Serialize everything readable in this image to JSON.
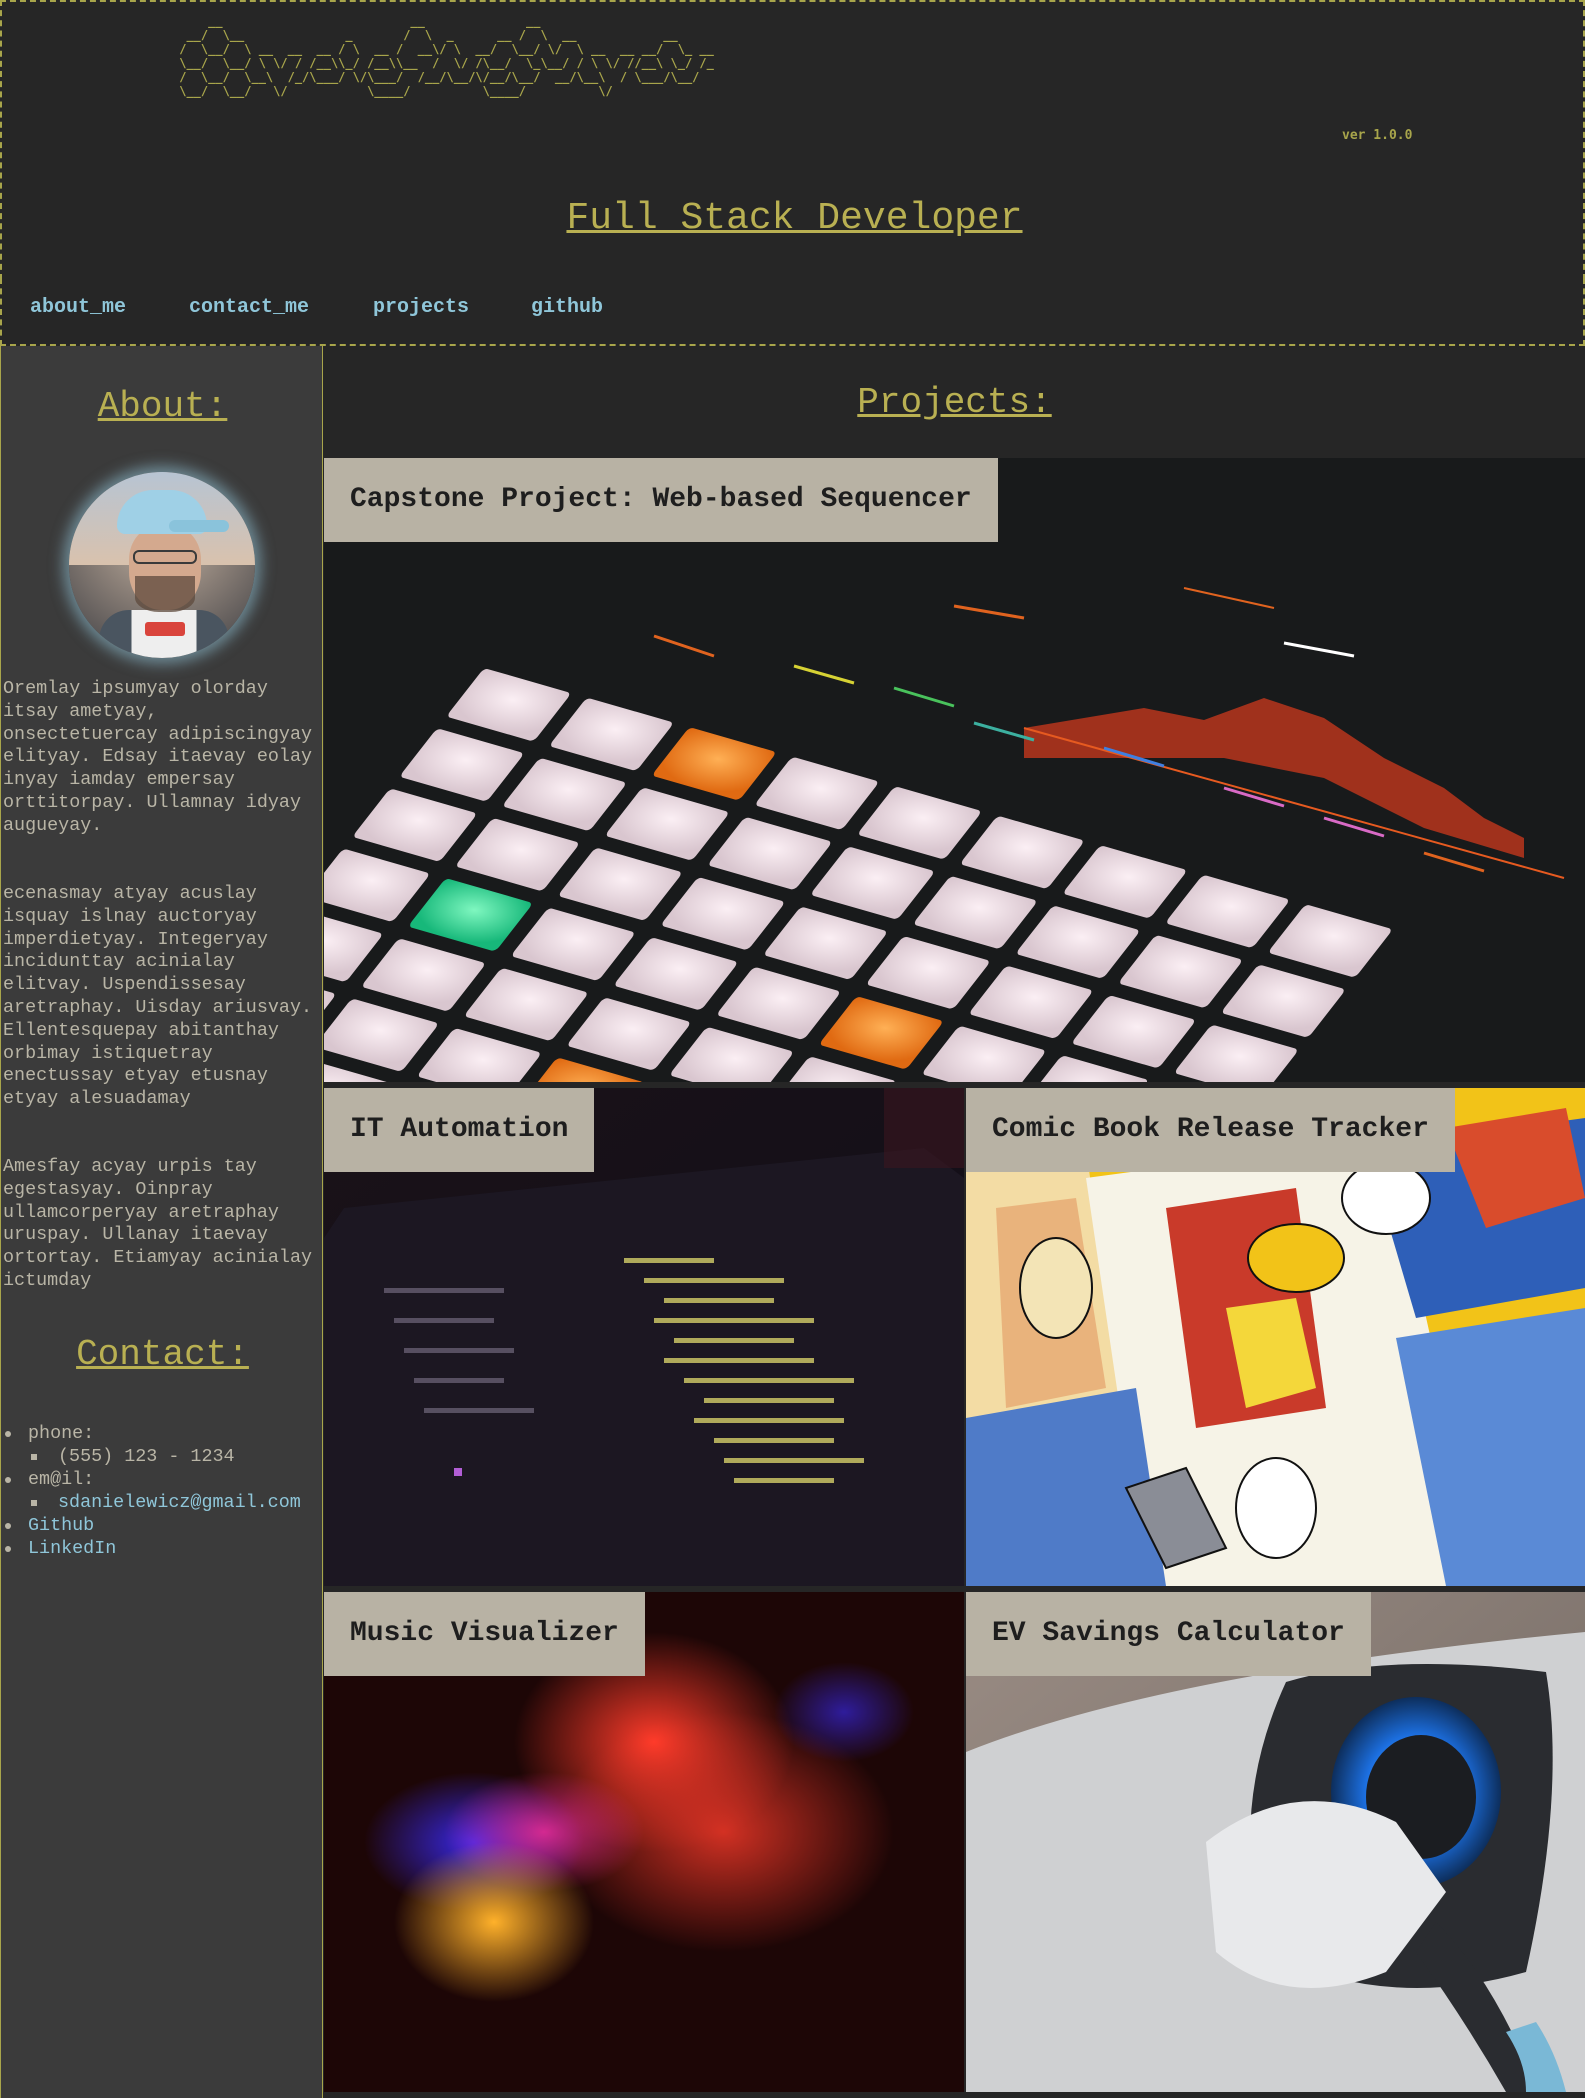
{
  "header": {
    "ascii_title": "     __                          __              __                    \n  __/  \\__              _       /  \\  _      __ /  \\  __            __    \n /  \\__/  \\ __  __  __ / \\  __ /  __\\/ \\  __/  \\__/ \\/  \\ __  __ __/  \\_ __\n \\__/  \\__/ \\ \\/ / /__\\\\_/ /__\\\\__  /  \\/ /\\__/  \\_\\__/ / \\ \\/ //__\\ \\_/ /_\n /  \\__/  \\__\\  /_/\\___/ \\/\\___/  /__/\\__/\\/__/\\__/  __/\\__\\  / \\___/\\__/\n \\__/  \\__/   \\/           \\____/          \\____/          \\/          ",
    "version": "ver 1.0.0",
    "subtitle": "Full Stack Developer"
  },
  "nav": {
    "items": [
      "about_me",
      "contact_me",
      "projects",
      "github"
    ]
  },
  "sidebar": {
    "about_heading": "About:",
    "paragraphs": [
      "Oremlay ipsumyay olorday itsay ametyay, onsectetuercay adipiscingyay elityay. Edsay itaevay eolay inyay iamday empersay orttitorpay. Ullamnay idyay augueyay.",
      "ecenasmay atyay acuslay isquay islnay auctoryay imperdietyay. Integeryay incidunttay acinialay elitvay. Uspendissesay aretraphay. Uisday ariusvay. Ellentesquepay abitanthay orbimay istiquetray enectussay etyay etusnay etyay alesuadamay",
      "Amesfay acyay urpis tay egestasyay. Oinpray ullamcorperyay aretraphay uruspay. Ullanay itaevay ortortay. Etiamyay acinialay ictumday"
    ],
    "contact_heading": "Contact:",
    "contact": {
      "phone_label": "phone:",
      "phone_value": "(555) 123 - 1234",
      "email_label": "em@il:",
      "email_value": "sdanielewicz@gmail.com",
      "github": "Github",
      "linkedin": "LinkedIn"
    }
  },
  "main": {
    "heading": "Projects:",
    "projects": [
      {
        "title": "Capstone Project: Web-based Sequencer",
        "image": "launchpad-pads"
      },
      {
        "title": "IT Automation",
        "image": "laptop-code"
      },
      {
        "title": "Comic Book Release Tracker",
        "image": "comic-page"
      },
      {
        "title": "Music Visualizer",
        "image": "led-blur"
      },
      {
        "title": "EV Savings Calculator",
        "image": "ev-charger"
      }
    ]
  },
  "colors": {
    "accent": "#a8a54b",
    "link": "#8fc6d9",
    "background": "#262626",
    "sidebar": "#3b3b3b",
    "label_bg": "#b8b2a4"
  }
}
